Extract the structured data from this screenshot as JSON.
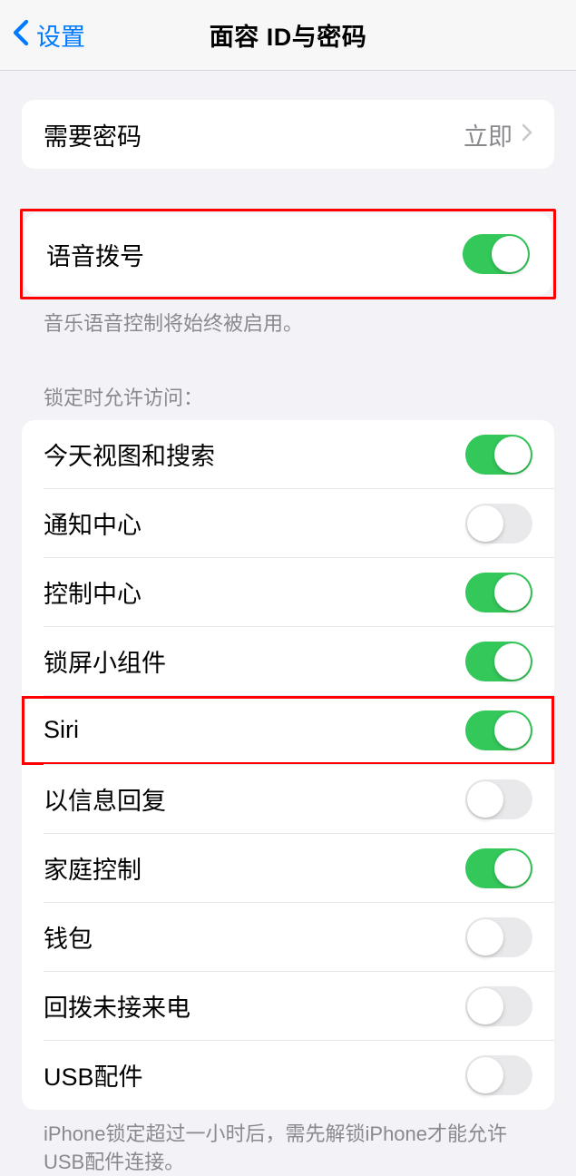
{
  "header": {
    "back_label": "设置",
    "title": "面容 ID与密码"
  },
  "require_passcode": {
    "label": "需要密码",
    "value": "立即"
  },
  "voice_dial": {
    "label": "语音拨号",
    "on": true,
    "footer": "音乐语音控制将始终被启用。"
  },
  "lock_access": {
    "header": "锁定时允许访问：",
    "items": [
      {
        "label": "今天视图和搜索",
        "on": true
      },
      {
        "label": "通知中心",
        "on": false
      },
      {
        "label": "控制中心",
        "on": true
      },
      {
        "label": "锁屏小组件",
        "on": true
      },
      {
        "label": "Siri",
        "on": true
      },
      {
        "label": "以信息回复",
        "on": false
      },
      {
        "label": "家庭控制",
        "on": true
      },
      {
        "label": "钱包",
        "on": false
      },
      {
        "label": "回拨未接来电",
        "on": false
      },
      {
        "label": "USB配件",
        "on": false
      }
    ],
    "footer": "iPhone锁定超过一小时后，需先解锁iPhone才能允许USB配件连接。"
  },
  "highlight_indices": [
    4
  ]
}
